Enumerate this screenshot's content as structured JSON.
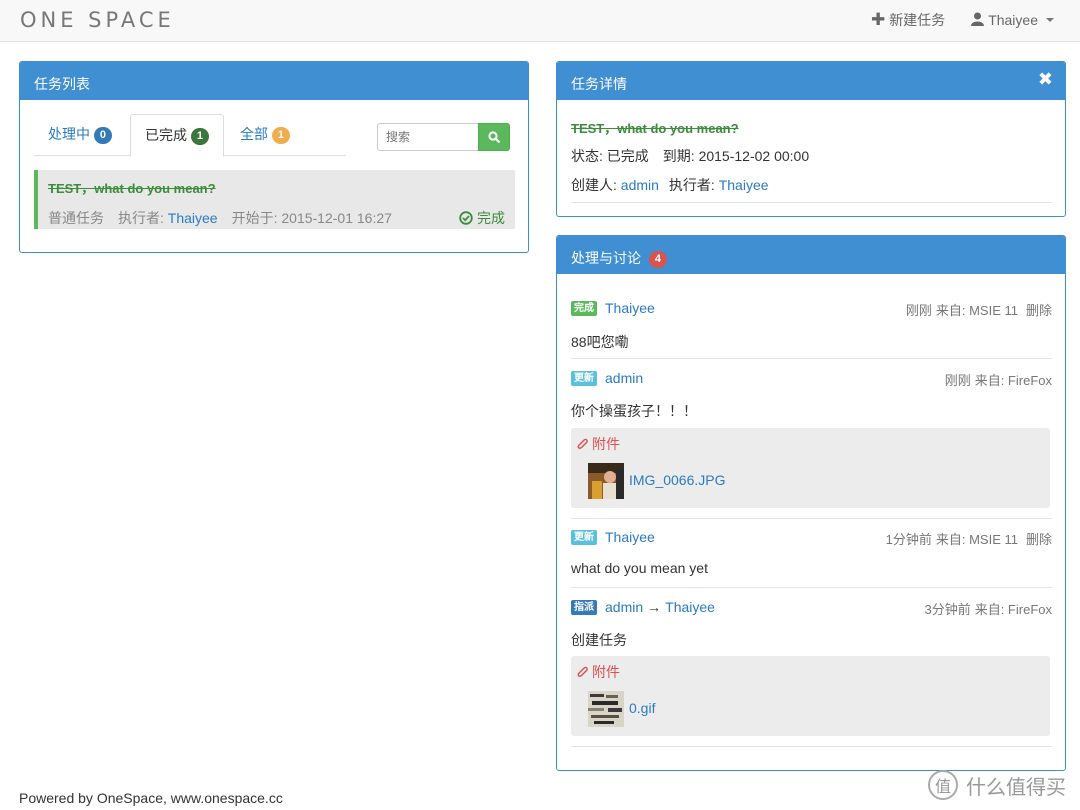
{
  "navbar": {
    "brand": "ONE SPACE",
    "new_task": "新建任务",
    "user": "Thaiyee"
  },
  "task_list": {
    "title": "任务列表",
    "tabs": [
      {
        "label": "处理中",
        "count": "0",
        "color": "#337ab7"
      },
      {
        "label": "已完成",
        "count": "1",
        "color": "#3c763d"
      },
      {
        "label": "全部",
        "count": "1",
        "color": "#f0ad4e"
      }
    ],
    "search_placeholder": "搜索",
    "item": {
      "title": "TEST，what do you mean?",
      "type": "普通任务",
      "assignee_label": "执行者:",
      "assignee": "Thaiyee",
      "start_label": "开始于:",
      "start": "2015-12-01 16:27",
      "status": "完成"
    }
  },
  "detail": {
    "title": "任务详情",
    "task_title": "TEST，what do you mean?",
    "status_label": "状态:",
    "status": "已完成",
    "due_label": "到期:",
    "due": "2015-12-02 00:00",
    "creator_label": "创建人:",
    "creator": "admin",
    "assignee_label": "执行者:",
    "assignee": "Thaiyee"
  },
  "discussion": {
    "title": "处理与讨论",
    "count": "4",
    "delete_label": "删除",
    "attach_label": "附件",
    "comments": [
      {
        "tag": "完成",
        "tag_color": "#5cb85c",
        "user": "Thaiyee",
        "time": "刚刚",
        "source": "来自: MSIE 11",
        "text": "88吧您嘞"
      },
      {
        "tag": "更新",
        "tag_color": "#5bc0de",
        "user": "admin",
        "time": "刚刚",
        "source": "来自: FireFox",
        "text": "你个操蛋孩子！！！",
        "attachment": "IMG_0066.JPG"
      },
      {
        "tag": "更新",
        "tag_color": "#5bc0de",
        "user": "Thaiyee",
        "time": "1分钟前",
        "source": "来自: MSIE 11",
        "text": "what do you mean yet"
      },
      {
        "tag": "指派",
        "tag_color": "#337ab7",
        "user": "admin",
        "to": "Thaiyee",
        "time": "3分钟前",
        "source": "来自: FireFox",
        "text": "创建任务",
        "attachment": "0.gif"
      }
    ]
  },
  "footer": {
    "text": "Powered by OneSpace, www.onespace.cc"
  },
  "watermark": {
    "text": "什么值得买",
    "logo": "值"
  }
}
